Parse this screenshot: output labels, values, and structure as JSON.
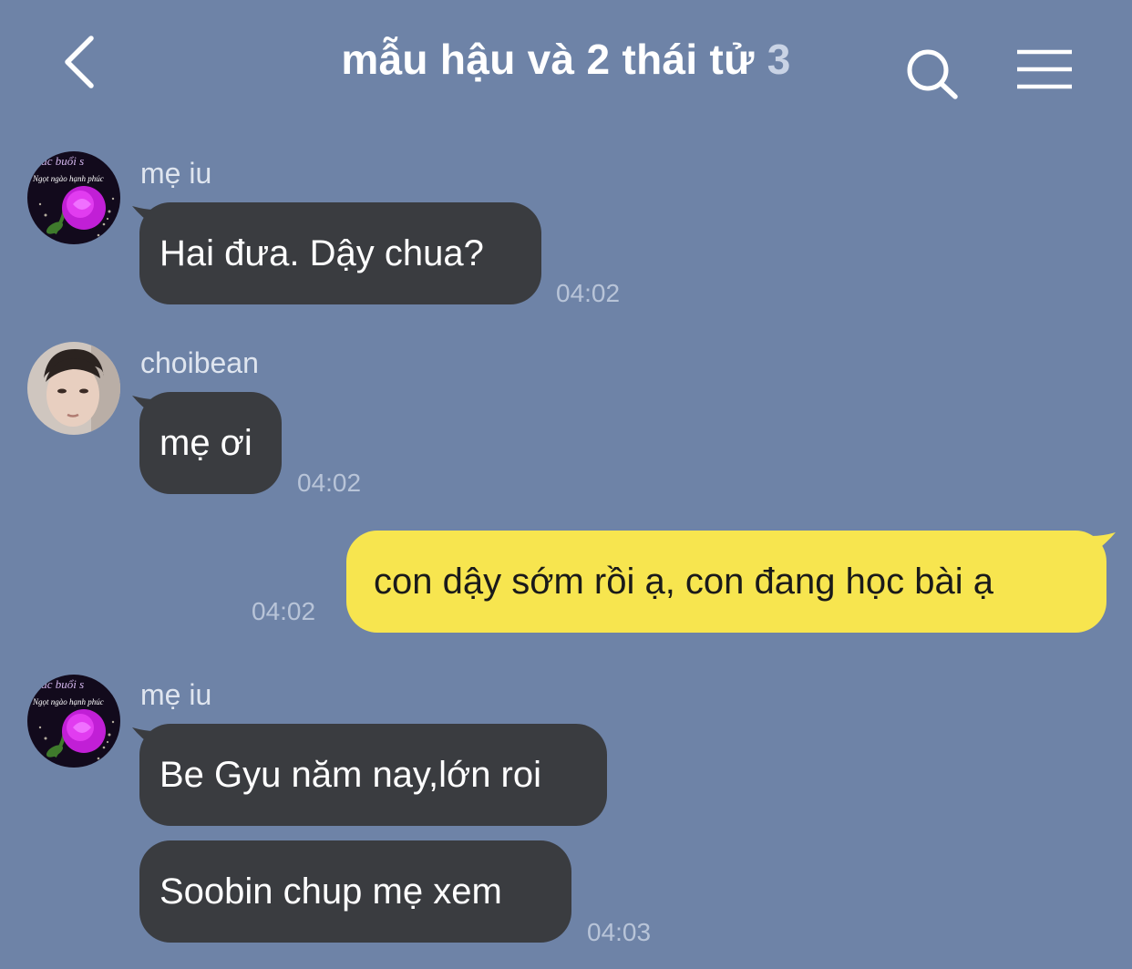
{
  "header": {
    "title": "mẫu hậu và 2 thái tử",
    "member_count": "3",
    "back_icon": "chevron-left-icon",
    "search_icon": "search-icon",
    "menu_icon": "hamburger-menu-icon"
  },
  "colors": {
    "background": "#6e83a7",
    "incoming_bubble": "#3a3c40",
    "outgoing_bubble": "#f7e54f"
  },
  "messages": [
    {
      "sender": "mẹ iu",
      "text": "Hai đưa. Dậy chua?",
      "time": "04:02",
      "direction": "incoming",
      "avatar": "rose-avatar"
    },
    {
      "sender": "choibean",
      "text": "mẹ ơi",
      "time": "04:02",
      "direction": "incoming",
      "avatar": "person-avatar"
    },
    {
      "text": "con dậy sớm rồi ạ, con đang học bài ạ",
      "time": "04:02",
      "direction": "outgoing"
    },
    {
      "sender": "mẹ iu",
      "text": "Be Gyu năm nay,lớn roi",
      "direction": "incoming",
      "avatar": "rose-avatar"
    },
    {
      "text": "Soobin chup mẹ xem",
      "time": "04:03",
      "direction": "incoming"
    }
  ],
  "avatar_text": {
    "line1": "Lúc buổi s",
    "line2": "Ngọt ngào hạnh phúc"
  }
}
